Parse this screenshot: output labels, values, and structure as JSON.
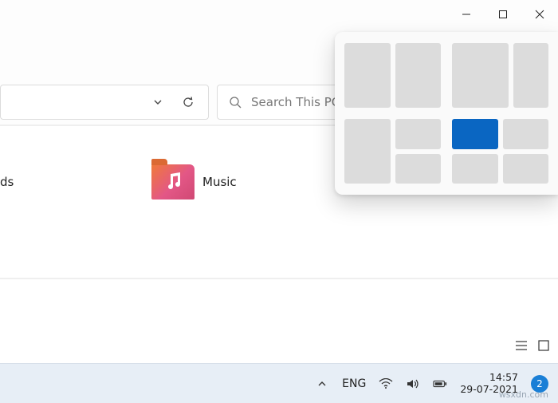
{
  "window": {
    "controls": {
      "minimize": "minimize",
      "maximize": "maximize",
      "close": "close"
    }
  },
  "toolbar": {
    "address_dropdown": "history-dropdown",
    "refresh": "refresh",
    "search_placeholder": "Search This PC"
  },
  "content": {
    "partial_item_left": "ds",
    "music_item": {
      "label": "Music"
    }
  },
  "snap": {
    "layouts": [
      {
        "id": "layoutA",
        "desc": "two-split-even"
      },
      {
        "id": "layoutB",
        "desc": "two-split-wide-left"
      },
      {
        "id": "layoutC",
        "desc": "three-split-left-tall"
      },
      {
        "id": "layoutD",
        "desc": "four-grid",
        "selected_cell": 0
      }
    ]
  },
  "statusbar": {
    "view_list": "list",
    "view_grid": "grid"
  },
  "taskbar": {
    "lang": "ENG",
    "wifi": "wifi",
    "sound": "sound",
    "battery": "battery",
    "time": "14:57",
    "date": "29-07-2021",
    "notifications": "2",
    "watermark": "wsxdn.com"
  }
}
